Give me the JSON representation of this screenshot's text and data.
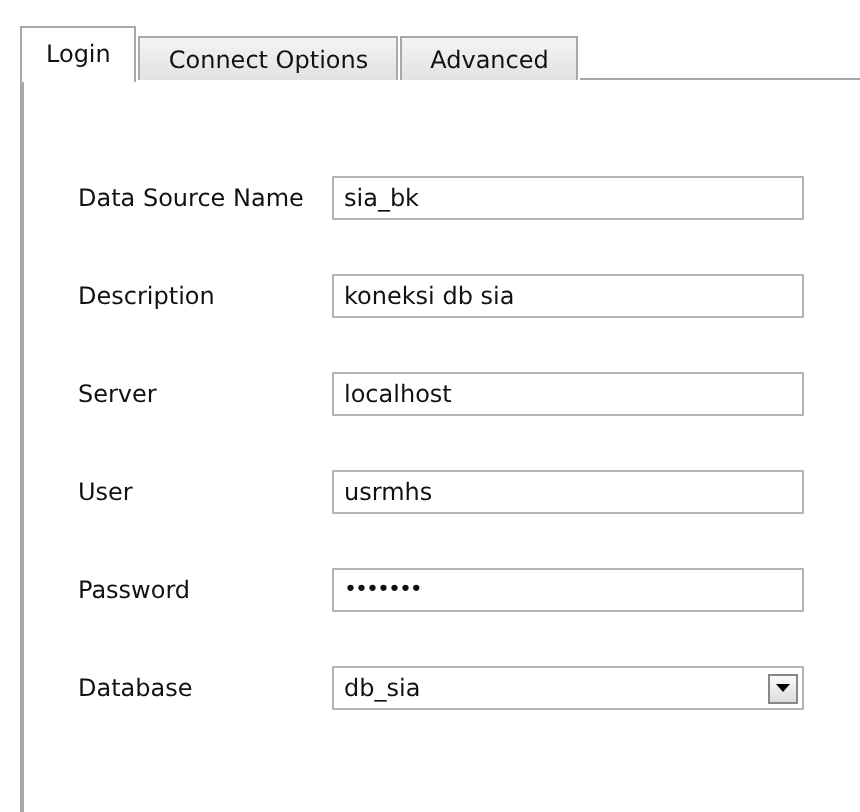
{
  "tabs": [
    {
      "label": "Login",
      "selected": true
    },
    {
      "label": "Connect Options",
      "selected": false
    },
    {
      "label": "Advanced",
      "selected": false
    }
  ],
  "fields": [
    {
      "label": "Data Source Name",
      "kind": "text",
      "value": "sia_bk"
    },
    {
      "label": "Description",
      "kind": "text",
      "value": "koneksi db sia"
    },
    {
      "label": "Server",
      "kind": "text",
      "value": "localhost"
    },
    {
      "label": "User",
      "kind": "text",
      "value": "usrmhs"
    },
    {
      "label": "Password",
      "kind": "password",
      "value": "•••••••"
    },
    {
      "label": "Database",
      "kind": "dropdown",
      "value": "db_sia"
    }
  ]
}
